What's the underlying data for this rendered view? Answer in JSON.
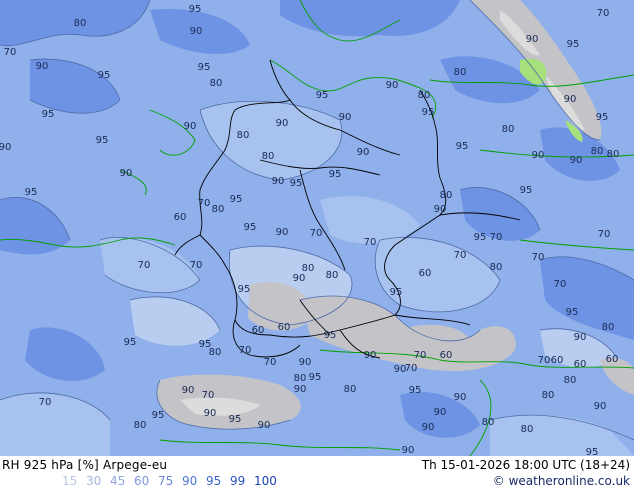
{
  "map": {
    "colors": {
      "rh_90_95": "#8fb0ea",
      "rh_95_99": "#6f93e4",
      "rh_80_90": "#a7c2ee",
      "rh_70_80": "#b8cdf0",
      "rh_60_70": "#c2d2ec",
      "rh_low": "#c4c4c8",
      "rh_very_low": "#dcdcdc",
      "green_band": "#a6e07a",
      "coastline": "#00a000",
      "border": "#000000",
      "contour": "#4d6aa8"
    },
    "contour_labels": [
      "95",
      "80",
      "90",
      "70",
      "90",
      "95",
      "95",
      "80",
      "95",
      "90",
      "95",
      "95",
      "90",
      "90",
      "95",
      "90",
      "95",
      "95",
      "90",
      "90",
      "80",
      "90",
      "80",
      "95",
      "80",
      "80",
      "90",
      "95",
      "95",
      "80",
      "90",
      "95",
      "70",
      "70",
      "90",
      "95",
      "90",
      "95",
      "90",
      "80",
      "80",
      "70",
      "80",
      "90",
      "95",
      "80",
      "95",
      "90",
      "70",
      "60",
      "70",
      "70",
      "95",
      "90",
      "80",
      "80",
      "70",
      "70",
      "60",
      "95",
      "70",
      "80",
      "70",
      "70",
      "95",
      "80",
      "90",
      "70",
      "60",
      "80",
      "80",
      "60",
      "90",
      "60",
      "80",
      "95",
      "80",
      "90",
      "90",
      "90",
      "95",
      "70",
      "60",
      "70",
      "90",
      "90",
      "95",
      "90",
      "80",
      "95",
      "90",
      "80",
      "70",
      "70",
      "80",
      "95",
      "60",
      "60",
      "95",
      "70",
      "95",
      "80",
      "90",
      "70",
      "90",
      "95",
      "90",
      "90",
      "95",
      "60",
      "70",
      "70",
      "80",
      "70",
      "90",
      "70",
      "80",
      "95",
      "90",
      "90",
      "70",
      "80",
      "95",
      "80",
      "70",
      "90",
      "95",
      "95",
      "90",
      "80",
      "60",
      "90",
      "70",
      "95",
      "80",
      "70",
      "90",
      "70",
      "80",
      "95",
      "60",
      "80",
      "70",
      "90",
      "95",
      "90",
      "70",
      "70",
      "95",
      "70",
      "80",
      "80",
      "95",
      "70",
      "90",
      "95",
      "95",
      "90",
      "95"
    ]
  },
  "footer": {
    "variable_label": "RH 925 hPa [%] Arpege-eu",
    "valid_time": "Th 15-01-2026 18:00 UTC (18+24)",
    "credit": "© weatheronline.co.uk",
    "legend": [
      {
        "value": "15",
        "color": "#b8c8e6"
      },
      {
        "value": "30",
        "color": "#a4b8e0"
      },
      {
        "value": "45",
        "color": "#8fa8dc"
      },
      {
        "value": "60",
        "color": "#7c98da"
      },
      {
        "value": "75",
        "color": "#6688d6"
      },
      {
        "value": "90",
        "color": "#4f76d2"
      },
      {
        "value": "95",
        "color": "#3a64cc"
      },
      {
        "value": "99",
        "color": "#2a52c4"
      },
      {
        "value": "100",
        "color": "#1c3fb8"
      }
    ]
  }
}
